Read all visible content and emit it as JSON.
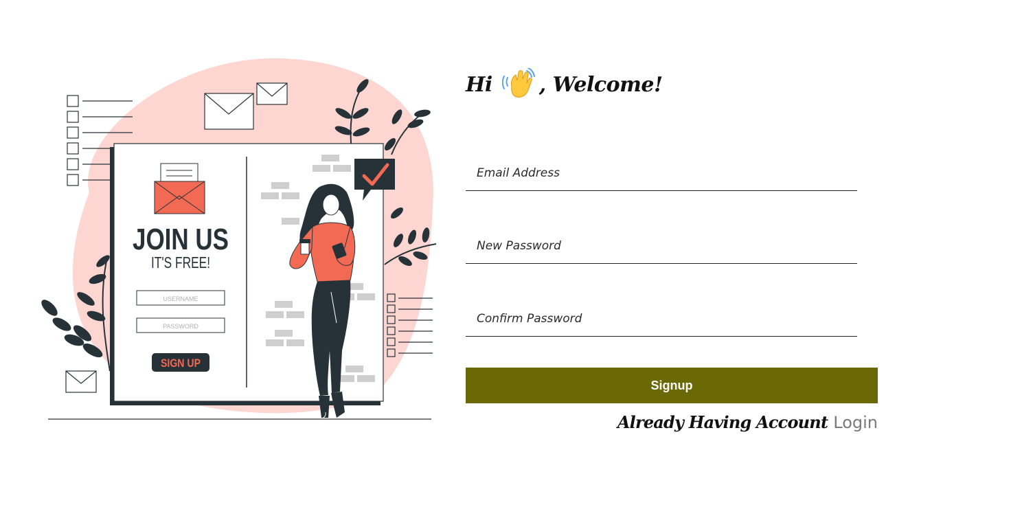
{
  "illustration": {
    "headline": "JOIN US",
    "subheadline": "IT'S FREE!",
    "username_placeholder": "USERNAME",
    "password_placeholder": "PASSWORD",
    "signup_label": "SIGN UP",
    "blob_color": "#fdd5d1",
    "accent_color": "#f26a53",
    "ink_color": "#263238"
  },
  "heading": {
    "prefix": "Hi",
    "emoji": "waving-hand-icon",
    "suffix": ", Welcome!"
  },
  "form": {
    "email_placeholder": "Email Address",
    "new_password_placeholder": "New Password",
    "confirm_password_placeholder": "Confirm Password",
    "signup_label": "Signup",
    "button_color": "#6b6806"
  },
  "footer": {
    "prompt": "Already Having Account",
    "login_label": "Login"
  }
}
